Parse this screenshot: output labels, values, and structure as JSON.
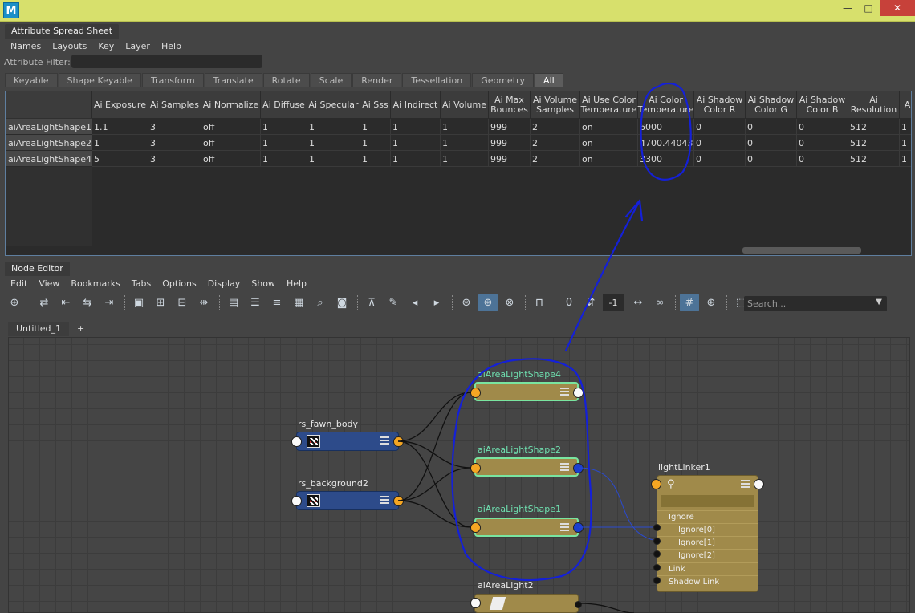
{
  "app": {
    "logo_letter": "M"
  },
  "window": {
    "minimize": "—",
    "maximize": "□",
    "close": "✕"
  },
  "spreadsheet": {
    "panel_title": "Attribute Spread Sheet",
    "menu": [
      "Names",
      "Layouts",
      "Key",
      "Layer",
      "Help"
    ],
    "filter_label": "Attribute Filter:",
    "filter_value": "",
    "tabs": [
      "Keyable",
      "Shape Keyable",
      "Transform",
      "Translate",
      "Rotate",
      "Scale",
      "Render",
      "Tessellation",
      "Geometry",
      "All"
    ],
    "active_tab": "All",
    "columns": [
      "Ai Exposure",
      "Ai Samples",
      "Ai Normalize",
      "Ai Diffuse",
      "Ai Specular",
      "Ai Sss",
      "Ai Indirect",
      "Ai Volume",
      "Ai Max Bounces",
      "Ai Volume Samples",
      "Ai Use Color Temperature",
      "Ai Color Temperature",
      "Ai Shadow Color R",
      "Ai Shadow Color G",
      "Ai Shadow Color B",
      "Ai Resolution",
      "A"
    ],
    "rows": [
      {
        "name": "aiAreaLightShape1",
        "values": [
          "1.1",
          "3",
          "off",
          "1",
          "1",
          "1",
          "1",
          "1",
          "999",
          "2",
          "on",
          "6000",
          "0",
          "0",
          "0",
          "512",
          "1"
        ]
      },
      {
        "name": "aiAreaLightShape2",
        "values": [
          "1",
          "3",
          "off",
          "1",
          "1",
          "1",
          "1",
          "1",
          "999",
          "2",
          "on",
          "4700.44043",
          "0",
          "0",
          "0",
          "512",
          "1"
        ]
      },
      {
        "name": "aiAreaLightShape4",
        "values": [
          "5",
          "3",
          "off",
          "1",
          "1",
          "1",
          "1",
          "1",
          "999",
          "2",
          "on",
          "3300",
          "0",
          "0",
          "0",
          "512",
          "1"
        ]
      }
    ]
  },
  "node_editor": {
    "panel_title": "Node Editor",
    "menu": [
      "Edit",
      "View",
      "Bookmarks",
      "Tabs",
      "Options",
      "Display",
      "Show",
      "Help"
    ],
    "zero_field": "0",
    "minus_field": "-1",
    "search_placeholder": "Search...",
    "tabs": [
      "Untitled_1",
      "+"
    ],
    "nodes": {
      "area4": "aiAreaLightShape4",
      "area2": "aiAreaLightShape2",
      "area1": "aiAreaLightShape1",
      "fawn": "rs_fawn_body",
      "bg": "rs_background2",
      "linker": "lightLinker1",
      "area_light": "aiAreaLight2"
    },
    "linker_rows": [
      "Ignore",
      "Ignore[0]",
      "Ignore[1]",
      "Ignore[2]",
      "Link",
      "Shadow Link"
    ]
  },
  "colors": {
    "title_bar": "#d7e06c",
    "selection_border": "#79e5a0",
    "annotation": "#1420d8",
    "node_gold": "#a08a4a",
    "node_blue": "#2d4b8a"
  }
}
